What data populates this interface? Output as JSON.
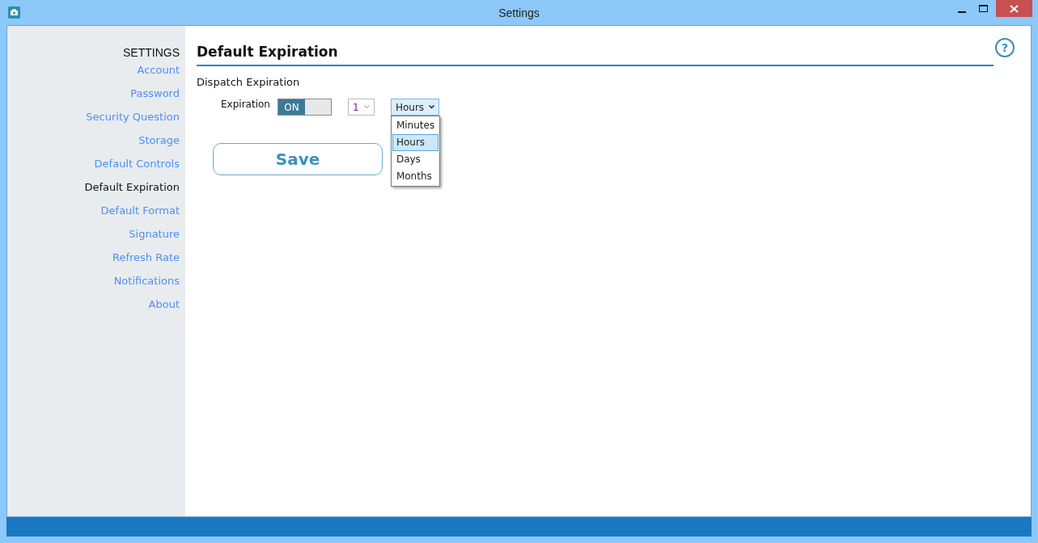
{
  "window": {
    "title": "Settings"
  },
  "sidebar": {
    "heading": "SETTINGS",
    "items": [
      {
        "label": "Account",
        "selected": false
      },
      {
        "label": "Password",
        "selected": false
      },
      {
        "label": "Security Question",
        "selected": false
      },
      {
        "label": "Storage",
        "selected": false
      },
      {
        "label": "Default Controls",
        "selected": false
      },
      {
        "label": "Default Expiration",
        "selected": true
      },
      {
        "label": "Default Format",
        "selected": false
      },
      {
        "label": "Signature",
        "selected": false
      },
      {
        "label": "Refresh Rate",
        "selected": false
      },
      {
        "label": "Notifications",
        "selected": false
      },
      {
        "label": "About",
        "selected": false
      }
    ]
  },
  "page": {
    "title": "Default Expiration",
    "help_button": "?",
    "section": "Dispatch Expiration",
    "expiration": {
      "label": "Expiration",
      "toggle": {
        "text": "ON",
        "on": true
      },
      "amount": {
        "value": "1"
      },
      "unit": {
        "value": "Hours",
        "expanded": true,
        "options": [
          {
            "label": "Minutes",
            "selected": false
          },
          {
            "label": "Hours",
            "selected": true
          },
          {
            "label": "Days",
            "selected": false
          },
          {
            "label": "Months",
            "selected": false
          }
        ]
      }
    },
    "save_button": "Save"
  }
}
